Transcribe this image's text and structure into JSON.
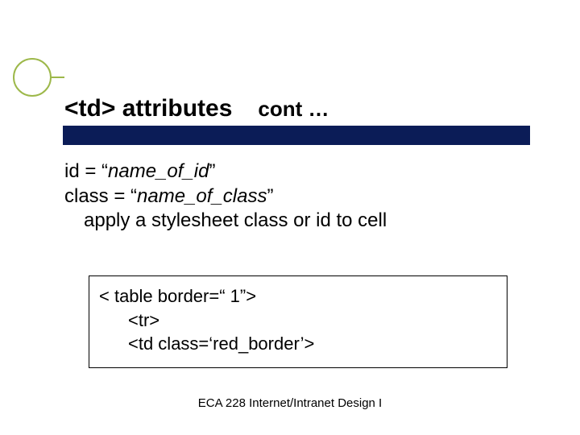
{
  "title": {
    "main": "<td> attributes",
    "cont": "cont …"
  },
  "body": {
    "line1_pre": "id = “",
    "line1_ital": "name_of_id",
    "line1_post": "”",
    "line2_pre": "class = “",
    "line2_ital": "name_of_class",
    "line2_post": "”",
    "line3": "apply a stylesheet class or id to cell"
  },
  "code": {
    "line1": "< table border=“ 1”>",
    "line2": "<tr>",
    "line3": "<td class=‘red_border’>"
  },
  "footer": "ECA 228  Internet/Intranet Design I",
  "colors": {
    "title_bar": "#0b1c57",
    "accent": "#9db84a"
  }
}
